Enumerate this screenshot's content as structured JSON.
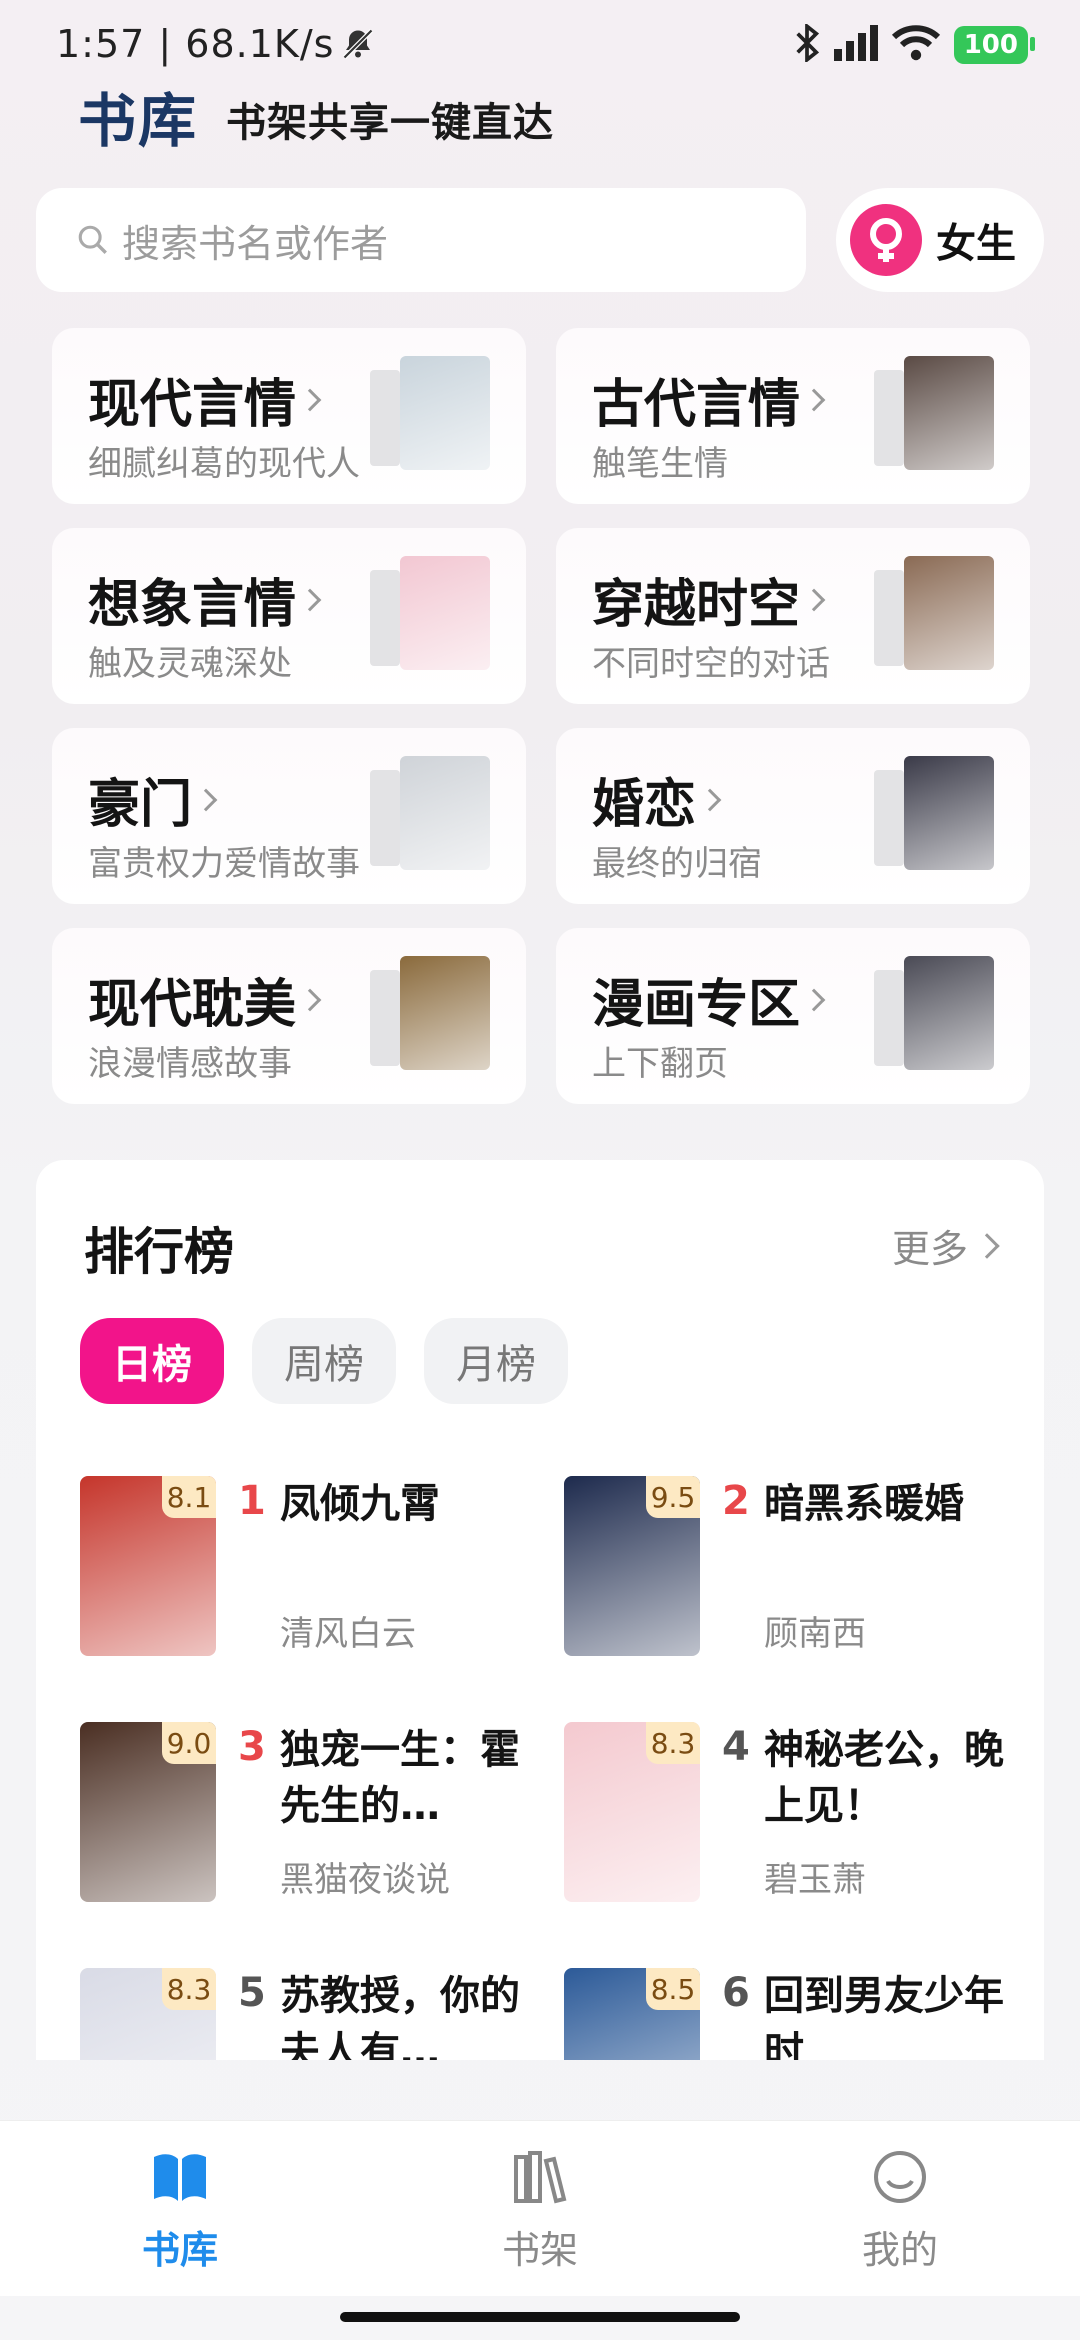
{
  "status_bar": {
    "time_speed": "1:57 | 68.1K/s",
    "battery": "100"
  },
  "header": {
    "logo": "书库",
    "slogan": "书架共享一键直达"
  },
  "search": {
    "placeholder": "搜索书名或作者"
  },
  "gender": {
    "label": "女生",
    "icon": "female-icon"
  },
  "categories": [
    {
      "title": "现代言情",
      "subtitle": "细腻纠葛的现代人",
      "cover_color": "#c9d4dc"
    },
    {
      "title": "古代言情",
      "subtitle": "触笔生情",
      "cover_color": "#5a4a44"
    },
    {
      "title": "想象言情",
      "subtitle": "触及灵魂深处",
      "cover_color": "#f2c7d2"
    },
    {
      "title": "穿越时空",
      "subtitle": "不同时空的对话",
      "cover_color": "#8a6a54"
    },
    {
      "title": "豪门",
      "subtitle": "富贵权力爱情故事",
      "cover_color": "#cfd3d8"
    },
    {
      "title": "婚恋",
      "subtitle": "最终的归宿",
      "cover_color": "#3a3a48"
    },
    {
      "title": "现代耽美",
      "subtitle": "浪漫情感故事",
      "cover_color": "#8a6a3c"
    },
    {
      "title": "漫画专区",
      "subtitle": "上下翻页",
      "cover_color": "#4a4a55"
    }
  ],
  "ranking": {
    "title": "排行榜",
    "more": "更多",
    "tabs": [
      "日榜",
      "周榜",
      "月榜"
    ],
    "active_tab": "日榜",
    "books": [
      {
        "rank": "1",
        "title": "凤倾九霄",
        "author": "清风白云",
        "score": "8.1",
        "cover_color": "#c5352b"
      },
      {
        "rank": "2",
        "title": "暗黑系暖婚",
        "author": "顾南西",
        "score": "9.5",
        "cover_color": "#1d2a4d"
      },
      {
        "rank": "3",
        "title": "独宠一生：霍先生的…",
        "author": "黑猫夜谈说",
        "score": "9.0",
        "cover_color": "#4a2e22"
      },
      {
        "rank": "4",
        "title": "神秘老公，晚上见！",
        "author": "碧玉萧",
        "score": "8.3",
        "cover_color": "#f4c9cf"
      },
      {
        "rank": "5",
        "title": "苏教授，你的夫人有…",
        "author": "",
        "score": "8.3",
        "cover_color": "#d9dbe6"
      },
      {
        "rank": "6",
        "title": "回到男友少年时",
        "author": "",
        "score": "8.5",
        "cover_color": "#2c5a98"
      }
    ]
  },
  "bottom_nav": [
    {
      "label": "书库",
      "icon": "book-open-icon",
      "active": true
    },
    {
      "label": "书架",
      "icon": "bookshelf-icon",
      "active": false
    },
    {
      "label": "我的",
      "icon": "smile-face-icon",
      "active": false
    }
  ],
  "colors": {
    "accent": "#f2148a",
    "nav_active": "#1f8ceb",
    "rank_top": "#e8474a"
  }
}
